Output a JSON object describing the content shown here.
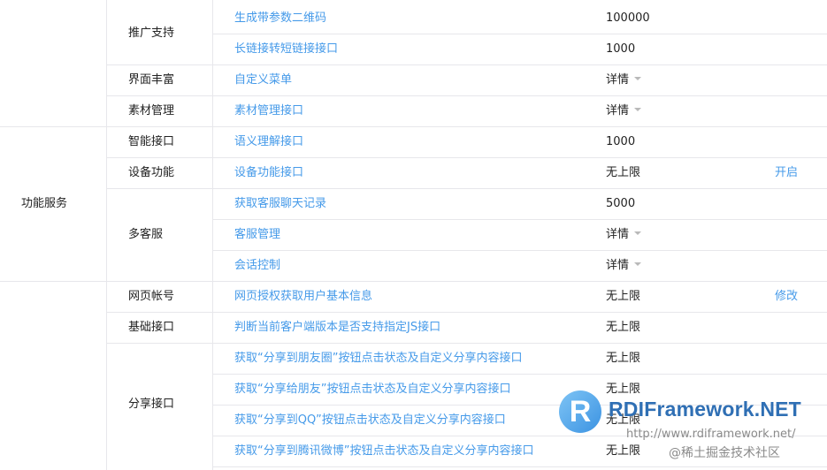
{
  "table": {
    "rows": [
      {
        "api": "生成带参数二维码",
        "value": "100000",
        "dropdown": false,
        "action": ""
      },
      {
        "api": "长链接转短链接接口",
        "value": "1000",
        "dropdown": false,
        "action": ""
      },
      {
        "api": "自定义菜单",
        "value": "详情",
        "dropdown": true,
        "action": ""
      },
      {
        "api": "素材管理接口",
        "value": "详情",
        "dropdown": true,
        "action": ""
      },
      {
        "api": "语义理解接口",
        "value": "1000",
        "dropdown": false,
        "action": ""
      },
      {
        "api": "设备功能接口",
        "value": "无上限",
        "dropdown": false,
        "action": "开启"
      },
      {
        "api": "获取客服聊天记录",
        "value": "5000",
        "dropdown": false,
        "action": ""
      },
      {
        "api": "客服管理",
        "value": "详情",
        "dropdown": true,
        "action": ""
      },
      {
        "api": "会话控制",
        "value": "详情",
        "dropdown": true,
        "action": ""
      },
      {
        "api": "网页授权获取用户基本信息",
        "value": "无上限",
        "dropdown": false,
        "action": "修改"
      },
      {
        "api": "判断当前客户端版本是否支持指定JS接口",
        "value": "无上限",
        "dropdown": false,
        "action": ""
      },
      {
        "api": "获取“分享到朋友圈”按钮点击状态及自定义分享内容接口",
        "value": "无上限",
        "dropdown": false,
        "action": ""
      },
      {
        "api": "获取“分享给朋友”按钮点击状态及自定义分享内容接口",
        "value": "无上限",
        "dropdown": false,
        "action": ""
      },
      {
        "api": "获取“分享到QQ”按钮点击状态及自定义分享内容接口",
        "value": "无上限",
        "dropdown": false,
        "action": ""
      },
      {
        "api": "获取“分享到腾讯微博”按钮点击状态及自定义分享内容接口",
        "value": "无上限",
        "dropdown": false,
        "action": ""
      }
    ],
    "groups": [
      {
        "label": "推广支持",
        "start": 0,
        "span": 2
      },
      {
        "label": "界面丰富",
        "start": 2,
        "span": 1
      },
      {
        "label": "素材管理",
        "start": 3,
        "span": 1
      },
      {
        "label": "智能接口",
        "start": 4,
        "span": 1
      },
      {
        "label": "设备功能",
        "start": 5,
        "span": 1
      },
      {
        "label": "多客服",
        "start": 6,
        "span": 3
      },
      {
        "label": "网页帐号",
        "start": 9,
        "span": 1
      },
      {
        "label": "基础接口",
        "start": 10,
        "span": 1
      },
      {
        "label": "分享接口",
        "start": 11,
        "span": 4
      }
    ],
    "sections": [
      {
        "label": "",
        "start": 0,
        "span": 4
      },
      {
        "label": "功能服务",
        "start": 4,
        "span": 5
      },
      {
        "label": "",
        "start": 9,
        "span": 6
      }
    ]
  },
  "watermark": {
    "logo_letter": "R",
    "brand": "RDIFramework.NET",
    "url": "http://www.rdiframework.net/",
    "credit": "@稀土掘金技术社区",
    "color": "#2f6fb4"
  }
}
